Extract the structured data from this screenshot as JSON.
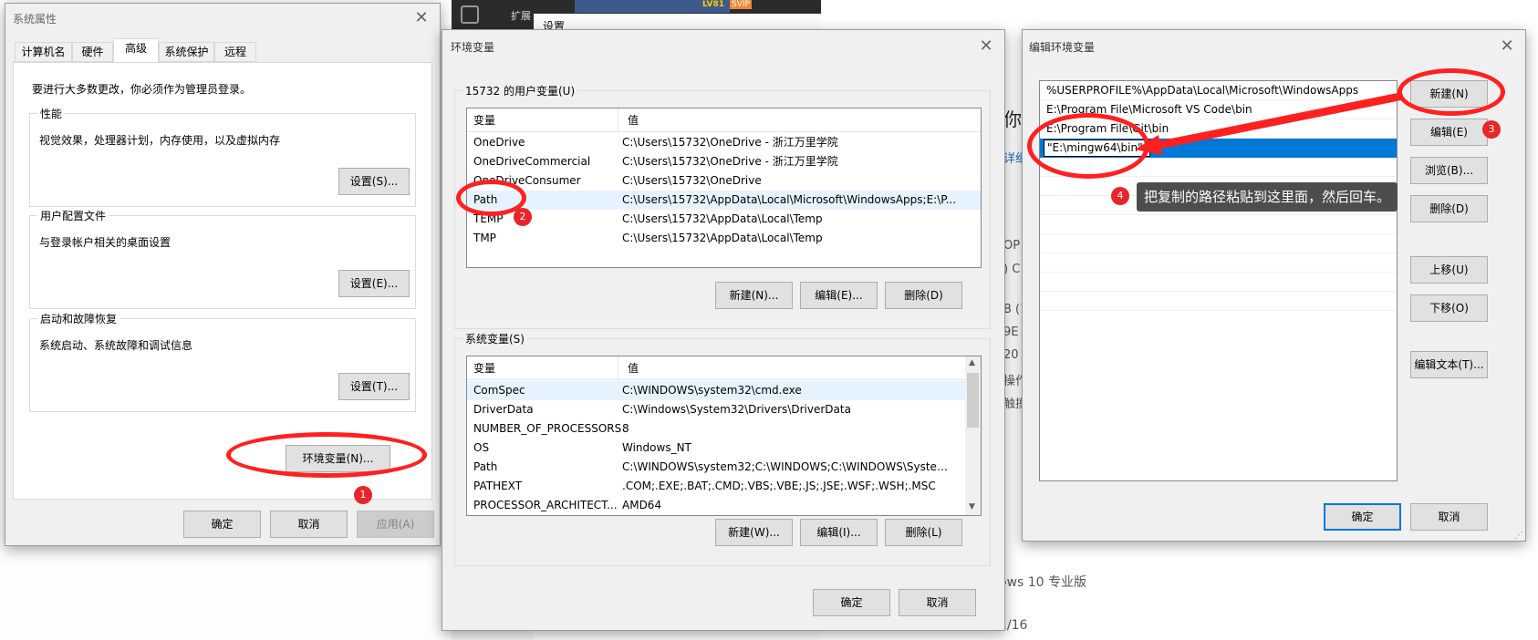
{
  "background": {
    "top_tab_text": "扩展",
    "settings_label": "设置",
    "badge_lv": "LV81",
    "badge_svip": "SVIP",
    "right_fragments": [
      "你",
      "详细",
      "OP",
      ") C",
      "B (1",
      "9E",
      "20",
      "操作",
      "触摸",
      "ows 10 专业版",
      "1/16"
    ]
  },
  "system_properties": {
    "title": "系统属性",
    "tabs": [
      "计算机名",
      "硬件",
      "高级",
      "系统保护",
      "远程"
    ],
    "active_tab": "高级",
    "admin_note": "要进行大多数更改，你必须作为管理员登录。",
    "groups": [
      {
        "label": "性能",
        "desc": "视觉效果，处理器计划，内存使用，以及虚拟内存",
        "button": "设置(S)..."
      },
      {
        "label": "用户配置文件",
        "desc": "与登录帐户相关的桌面设置",
        "button": "设置(E)..."
      },
      {
        "label": "启动和故障恢复",
        "desc": "系统启动、系统故障和调试信息",
        "button": "设置(T)..."
      }
    ],
    "env_button": "环境变量(N)...",
    "ok": "确定",
    "cancel": "取消",
    "apply": "应用(A)"
  },
  "env_vars": {
    "title": "环境变量",
    "user_section": "15732 的用户变量(U)",
    "col_var": "变量",
    "col_val": "值",
    "user_rows": [
      {
        "name": "OneDrive",
        "value": "C:\\Users\\15732\\OneDrive - 浙江万里学院"
      },
      {
        "name": "OneDriveCommercial",
        "value": "C:\\Users\\15732\\OneDrive - 浙江万里学院"
      },
      {
        "name": "OneDriveConsumer",
        "value": "C:\\Users\\15732\\OneDrive"
      },
      {
        "name": "Path",
        "value": "C:\\Users\\15732\\AppData\\Local\\Microsoft\\WindowsApps;E:\\P..."
      },
      {
        "name": "TEMP",
        "value": "C:\\Users\\15732\\AppData\\Local\\Temp"
      },
      {
        "name": "TMP",
        "value": "C:\\Users\\15732\\AppData\\Local\\Temp"
      }
    ],
    "user_new": "新建(N)...",
    "user_edit": "编辑(E)...",
    "user_delete": "删除(D)",
    "system_section": "系统变量(S)",
    "system_rows": [
      {
        "name": "ComSpec",
        "value": "C:\\WINDOWS\\system32\\cmd.exe"
      },
      {
        "name": "DriverData",
        "value": "C:\\Windows\\System32\\Drivers\\DriverData"
      },
      {
        "name": "NUMBER_OF_PROCESSORS",
        "value": "8"
      },
      {
        "name": "OS",
        "value": "Windows_NT"
      },
      {
        "name": "Path",
        "value": "C:\\WINDOWS\\system32;C:\\WINDOWS;C:\\WINDOWS\\System..."
      },
      {
        "name": "PATHEXT",
        "value": ".COM;.EXE;.BAT;.CMD;.VBS;.VBE;.JS;.JSE;.WSF;.WSH;.MSC"
      },
      {
        "name": "PROCESSOR_ARCHITECT...",
        "value": "AMD64"
      }
    ],
    "sys_new": "新建(W)...",
    "sys_edit": "编辑(I)...",
    "sys_delete": "删除(L)",
    "ok": "确定",
    "cancel": "取消"
  },
  "edit_env": {
    "title": "编辑环境变量",
    "entries": [
      "%USERPROFILE%\\AppData\\Local\\Microsoft\\WindowsApps",
      "E:\\Program File\\Microsoft VS Code\\bin",
      "E:\\Program File\\Git\\bin"
    ],
    "editing_value": "\"E:\\mingw64\\bin\"",
    "buttons": [
      "新建(N)",
      "编辑(E)",
      "浏览(B)...",
      "删除(D)",
      "上移(U)",
      "下移(O)",
      "编辑文本(T)..."
    ],
    "ok": "确定",
    "cancel": "取消"
  },
  "annotations": {
    "step1": "1",
    "step2": "2",
    "step3": "3",
    "step4": "4",
    "tooltip": "把复制的路径粘贴到这里面，然后回车。",
    "color": "#ff2020"
  }
}
